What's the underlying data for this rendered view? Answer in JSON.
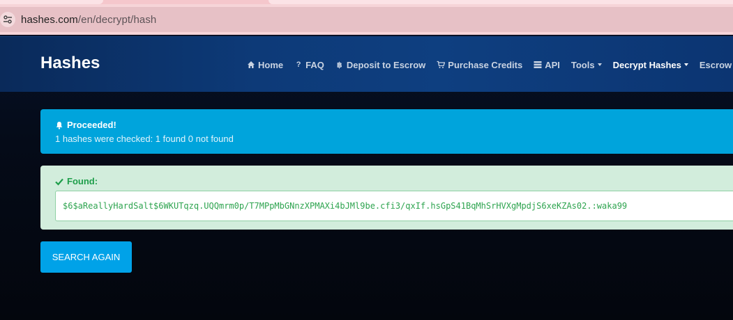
{
  "browser": {
    "url_host": "hashes.com",
    "url_path": "/en/decrypt/hash"
  },
  "header": {
    "brand": "Hashes",
    "nav": [
      {
        "label": "Home",
        "icon": "home-icon"
      },
      {
        "label": "FAQ",
        "icon": "question-icon"
      },
      {
        "label": "Deposit to Escrow",
        "icon": "bitcoin-icon"
      },
      {
        "label": "Purchase Credits",
        "icon": "cart-icon"
      },
      {
        "label": "API",
        "icon": "server-icon"
      },
      {
        "label": "Tools",
        "dropdown": true
      },
      {
        "label": "Decrypt Hashes",
        "dropdown": true,
        "active": true
      },
      {
        "label": "Escrow"
      }
    ]
  },
  "info_alert": {
    "title": "Proceeded!",
    "message": "1 hashes were checked: 1 found 0 not found",
    "icon": "bell-icon",
    "color": "#00a4dc"
  },
  "found_alert": {
    "title": "Found:",
    "icon": "check-icon",
    "result": "$6$aReallyHardSalt$6WKUTqzq.UQQmrm0p/T7MPpMbGNnzXPMAXi4bJMl9be.cfi3/qxIf.hsGpS41BqMhSrHVXgMpdjS6xeKZAs02.:waka99",
    "color": "#1e9e4a"
  },
  "actions": {
    "search_again": "SEARCH AGAIN"
  }
}
